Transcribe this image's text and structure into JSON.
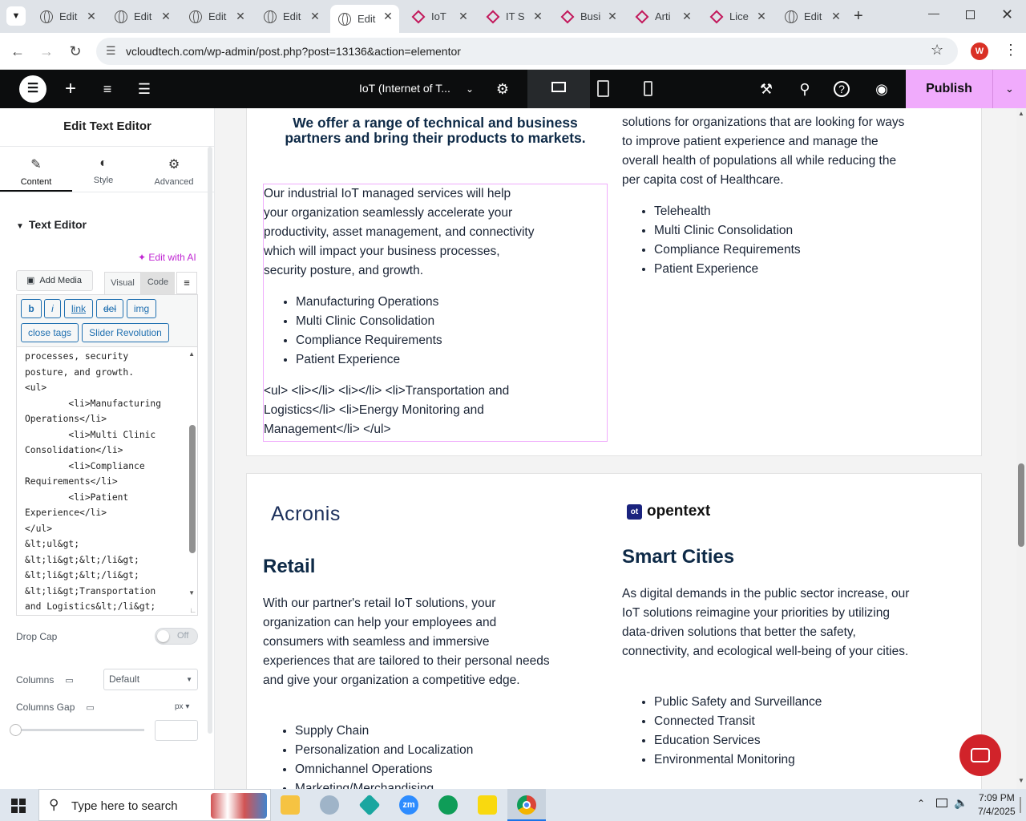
{
  "browser": {
    "tabs": [
      {
        "label": "Edit",
        "icon": "globe-icon"
      },
      {
        "label": "Edit",
        "icon": "globe-icon"
      },
      {
        "label": "Edit",
        "icon": "globe-icon"
      },
      {
        "label": "Edit",
        "icon": "globe-icon"
      },
      {
        "label": "Edit",
        "icon": "globe-icon",
        "active": true
      },
      {
        "label": "IoT",
        "icon": "diamond-icon"
      },
      {
        "label": "IT S",
        "icon": "diamond-icon"
      },
      {
        "label": "Busi",
        "icon": "diamond-icon"
      },
      {
        "label": "Arti",
        "icon": "diamond-icon"
      },
      {
        "label": "Lice",
        "icon": "diamond-icon"
      },
      {
        "label": "Edit",
        "icon": "globe-icon"
      }
    ],
    "url": "vcloudtech.com/wp-admin/post.php?post=13136&action=elementor",
    "profile_initial": "W"
  },
  "elementor": {
    "page_name": "IoT (Internet of T...",
    "publish_label": "Publish"
  },
  "panel": {
    "title": "Edit Text Editor",
    "tabs": [
      "Content",
      "Style",
      "Advanced"
    ],
    "section": "Text Editor",
    "edit_ai": "Edit with AI",
    "add_media": "Add Media",
    "mode_visual": "Visual",
    "mode_code": "Code",
    "quicktags": [
      "b",
      "i",
      "link",
      "del",
      "img",
      "close tags",
      "Slider Revolution"
    ],
    "code_text": "processes, security\nposture, and growth.\n<ul>\n        <li>Manufacturing\nOperations</li>\n        <li>Multi Clinic\nConsolidation</li>\n        <li>Compliance\nRequirements</li>\n        <li>Patient\nExperience</li>\n</ul>\n&lt;ul&gt;\n&lt;li&gt;&lt;/li&gt;\n&lt;li&gt;&lt;/li&gt;\n&lt;li&gt;Transportation\nand Logistics&lt;/li&gt;",
    "drop_cap_label": "Drop Cap",
    "drop_cap_value": "Off",
    "columns_label": "Columns",
    "columns_value": "Default",
    "columns_gap_label": "Columns Gap",
    "columns_gap_unit": "px"
  },
  "canvas": {
    "offer_heading": "We offer a range of technical and business partners and bring their products to markets.",
    "industrial_text": "Our industrial IoT managed services will help your organization seamlessly accelerate your productivity, asset management, and connectivity which will impact your business processes, security posture, and growth.",
    "industrial_list": [
      "Manufacturing Operations",
      "Multi Clinic Consolidation",
      "Compliance Requirements",
      "Patient Experience"
    ],
    "raw_html_text": "<ul> <li></li> <li></li> <li>Transportation and Logistics</li> <li>Energy Monitoring and Management</li> </ul>",
    "healthcare_text": "solutions for organizations that are looking for ways to improve patient experience and manage the overall health of populations all while reducing the per capita cost of Healthcare.",
    "healthcare_list": [
      "Telehealth",
      "Multi Clinic Consolidation",
      "Compliance Requirements",
      "Patient Experience"
    ],
    "logo_left": "Acronis",
    "logo_right": "opentext",
    "retail_title": "Retail",
    "retail_text": "With our partner's retail IoT solutions, your organization can help your employees and consumers with seamless and immersive experiences that are tailored to their personal needs and give your organization a competitive edge.",
    "retail_list": [
      "Supply Chain",
      "Personalization and Localization",
      "Omnichannel Operations",
      "Marketing/Merchandising"
    ],
    "smart_title": "Smart Cities",
    "smart_text": "As digital demands in the public sector increase, our IoT solutions reimagine your priorities by utilizing data-driven solutions that better the safety, connectivity, and ecological well-being of your cities.",
    "smart_list": [
      "Public Safety and Surveillance",
      "Connected Transit",
      "Education Services",
      "Environmental Monitoring"
    ]
  },
  "taskbar": {
    "search_placeholder": "Type here to search",
    "time": "7:09 PM",
    "date": "7/4/2025"
  }
}
